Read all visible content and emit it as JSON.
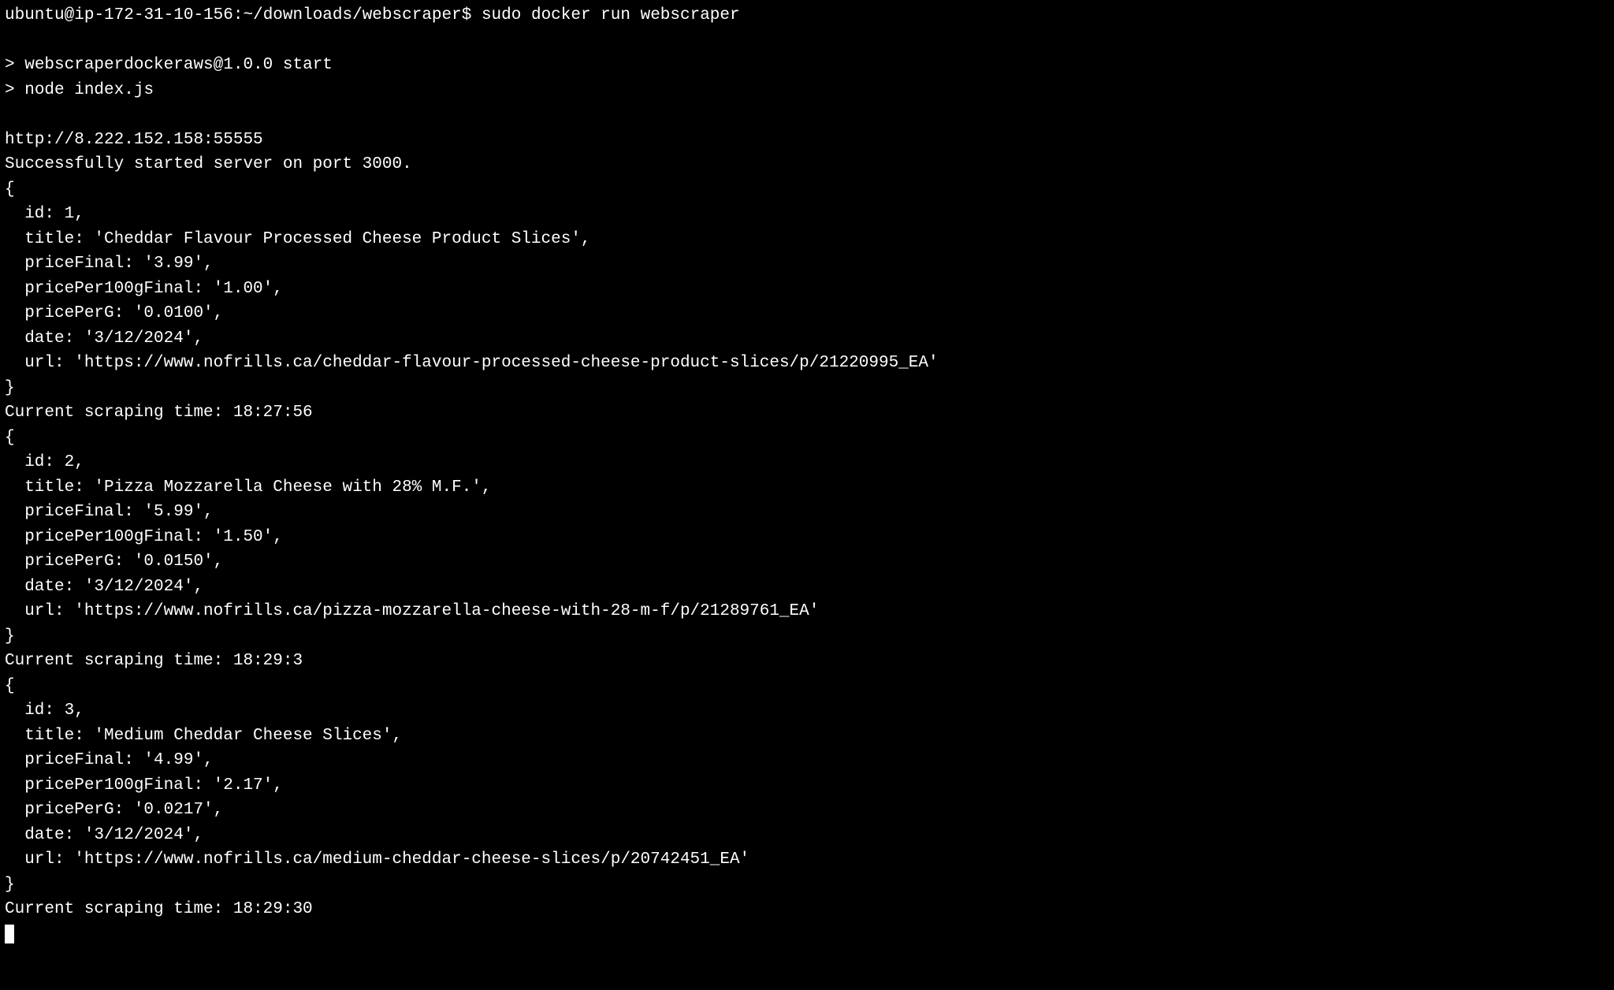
{
  "prompt": {
    "user": "ubuntu",
    "host": "ip-172-31-10-156",
    "path": "~/downloads/webscraper",
    "symbol": "$",
    "command": "sudo docker run webscraper"
  },
  "npm_start": {
    "package": "webscraperdockeraws@1.0.0",
    "script": "start",
    "cmd": "node index.js"
  },
  "server": {
    "proxy_url": "http://8.222.152.158:55555",
    "start_msg": "Successfully started server on port 3000."
  },
  "scrapes": [
    {
      "id": 1,
      "title": "Cheddar Flavour Processed Cheese Product Slices",
      "priceFinal": "3.99",
      "pricePer100gFinal": "1.00",
      "pricePerG": "0.0100",
      "date": "3/12/2024",
      "url": "https://www.nofrills.ca/cheddar-flavour-processed-cheese-product-slices/p/21220995_EA",
      "time_after": "18:27:56"
    },
    {
      "id": 2,
      "title": "Pizza Mozzarella Cheese with 28% M.F.",
      "priceFinal": "5.99",
      "pricePer100gFinal": "1.50",
      "pricePerG": "0.0150",
      "date": "3/12/2024",
      "url": "https://www.nofrills.ca/pizza-mozzarella-cheese-with-28-m-f/p/21289761_EA",
      "time_after": "18:29:3"
    },
    {
      "id": 3,
      "title": "Medium Cheddar Cheese Slices",
      "priceFinal": "4.99",
      "pricePer100gFinal": "2.17",
      "pricePerG": "0.0217",
      "date": "3/12/2024",
      "url": "https://www.nofrills.ca/medium-cheddar-cheese-slices/p/20742451_EA",
      "time_after": "18:29:30"
    }
  ],
  "labels": {
    "scraping_time": "Current scraping time:"
  }
}
